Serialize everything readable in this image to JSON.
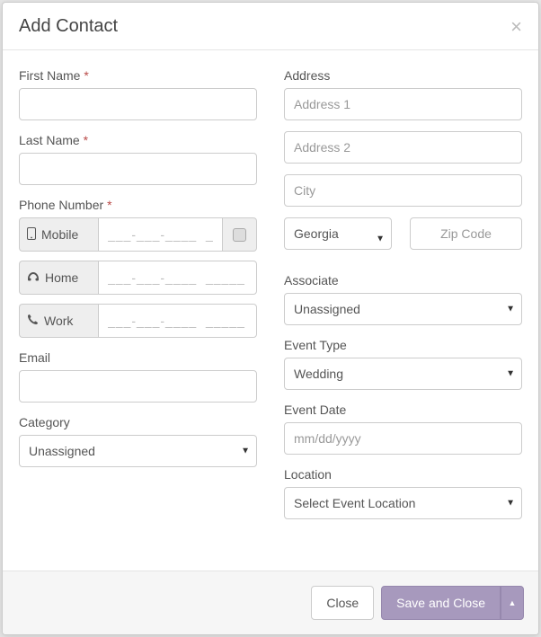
{
  "header": {
    "title": "Add Contact"
  },
  "left": {
    "first_name_label": "First Name",
    "last_name_label": "Last Name",
    "phone_label": "Phone Number",
    "phones": {
      "mobile": "Mobile",
      "home": "Home",
      "work": "Work",
      "mask": "___-___-____  _____"
    },
    "email_label": "Email",
    "category_label": "Category",
    "category_value": "Unassigned"
  },
  "right": {
    "address_label": "Address",
    "address1_ph": "Address 1",
    "address2_ph": "Address 2",
    "city_ph": "City",
    "state_value": "Georgia",
    "zip_ph": "Zip Code",
    "associate_label": "Associate",
    "associate_value": "Unassigned",
    "event_type_label": "Event Type",
    "event_type_value": "Wedding",
    "event_date_label": "Event Date",
    "event_date_ph": "mm/dd/yyyy",
    "location_label": "Location",
    "location_value": "Select Event Location"
  },
  "footer": {
    "close": "Close",
    "save": "Save and Close"
  },
  "req": "*"
}
